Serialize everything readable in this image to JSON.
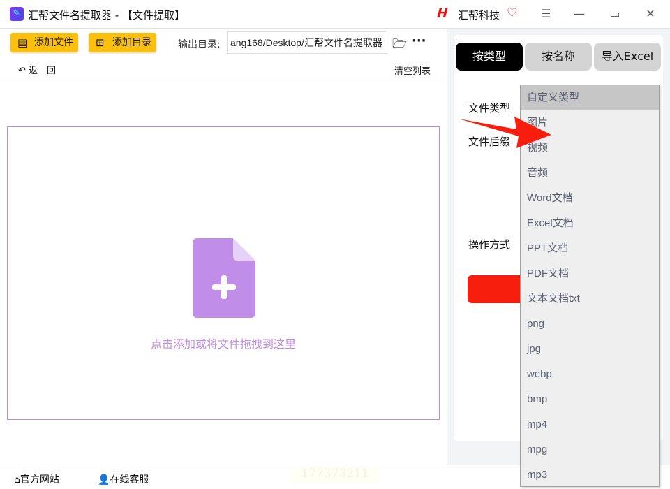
{
  "title": "汇帮文件名提取器 - 【文件提取】",
  "brand": "汇帮科技",
  "toolbar": {
    "add_file": "添加文件",
    "add_dir": "添加目录",
    "output_label": "输出目录:",
    "output_path": "ang168/Desktop/汇帮文件名提取器",
    "back": "返　回",
    "clear": "清空列表"
  },
  "drop": {
    "text": "点击添加或将文件拖拽到这里"
  },
  "footer": {
    "website": "官方网站",
    "support": "在线客服",
    "phone": "177373211"
  },
  "tabs": [
    "按类型",
    "按名称",
    "导入Excel"
  ],
  "labels": {
    "type": "文件类型",
    "suffix": "文件后缀",
    "mode": "操作方式"
  },
  "dropdown": {
    "options": [
      "自定义类型",
      "图片",
      "视频",
      "音频",
      "Word文档",
      "Excel文档",
      "PPT文档",
      "PDF文档",
      "文本文档txt",
      "png",
      "jpg",
      "webp",
      "bmp",
      "mp4",
      "mpg",
      "mp3"
    ],
    "selected": "自定义类型"
  },
  "colors": {
    "accent": "#fbbf0d",
    "purple": "#c08de8",
    "red": "#f81e0e"
  }
}
